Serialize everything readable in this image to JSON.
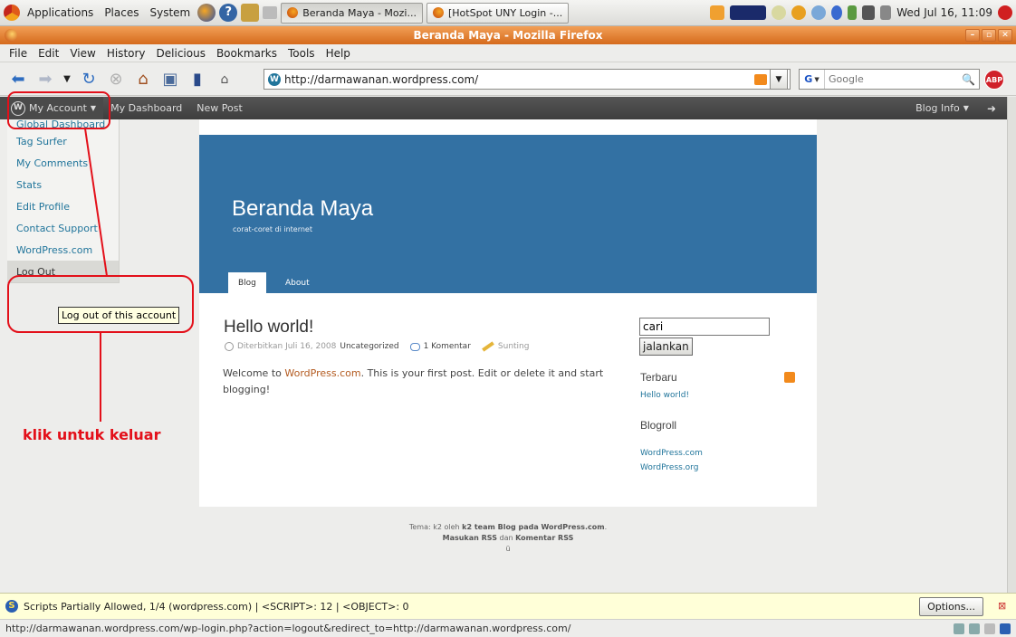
{
  "panel": {
    "menus": [
      "Applications",
      "Places",
      "System"
    ],
    "tasks": [
      {
        "label": "Beranda Maya - Mozi...",
        "active": true
      },
      {
        "label": "[HotSpot UNY Login -...",
        "active": false
      }
    ],
    "clock": "Wed Jul 16, 11:09"
  },
  "window": {
    "title": "Beranda Maya - Mozilla Firefox"
  },
  "menubar": [
    "File",
    "Edit",
    "View",
    "History",
    "Delicious",
    "Bookmarks",
    "Tools",
    "Help"
  ],
  "navbar": {
    "url": "http://darmawanan.wordpress.com/",
    "search_placeholder": "Google",
    "search_engine_icon": "G",
    "adblock": "ABP"
  },
  "wpbar": {
    "my_account": "My Account",
    "my_dashboard": "My Dashboard",
    "new_post": "New Post",
    "blog_info": "Blog Info"
  },
  "dropdown": {
    "items": [
      "Global Dashboard",
      "Tag Surfer",
      "My Comments",
      "Stats",
      "Edit Profile",
      "Contact Support",
      "WordPress.com",
      "Log Out"
    ],
    "tooltip": "Log out of this account"
  },
  "blog": {
    "title": "Beranda Maya",
    "description": "corat-coret di internet",
    "tabs": [
      "Blog",
      "About"
    ],
    "post": {
      "title": "Hello world!",
      "published": "Diterbitkan Juli 16, 2008",
      "category": "Uncategorized",
      "comments": "1 Komentar",
      "edit": "Sunting",
      "body_prefix": "Welcome to ",
      "body_link": "WordPress.com",
      "body_suffix": ". This is your first post. Edit or delete it and start blogging!"
    },
    "sidebar": {
      "search_value": "cari",
      "search_button": "jalankan",
      "recent_heading": "Terbaru",
      "recent_link": "Hello world!",
      "blogroll_heading": "Blogroll",
      "blogroll_links": [
        "WordPress.com",
        "WordPress.org"
      ]
    },
    "footer": {
      "line1_prefix": "Tema: k2 oleh ",
      "line1_bold": "k2 team Blog pada WordPress.com",
      "line2_a": "Masukan RSS",
      "line2_mid": " dan ",
      "line2_b": "Komentar RSS"
    }
  },
  "annotation": {
    "text": "klik untuk keluar",
    "color": "#e3101a"
  },
  "noscript": {
    "message": "Scripts Partially Allowed, 1/4 (wordpress.com) | <SCRIPT>: 12 | <OBJECT>: 0",
    "options": "Options..."
  },
  "status": {
    "url": "http://darmawanan.wordpress.com/wp-login.php?action=logout&redirect_to=http://darmawanan.wordpress.com/"
  }
}
